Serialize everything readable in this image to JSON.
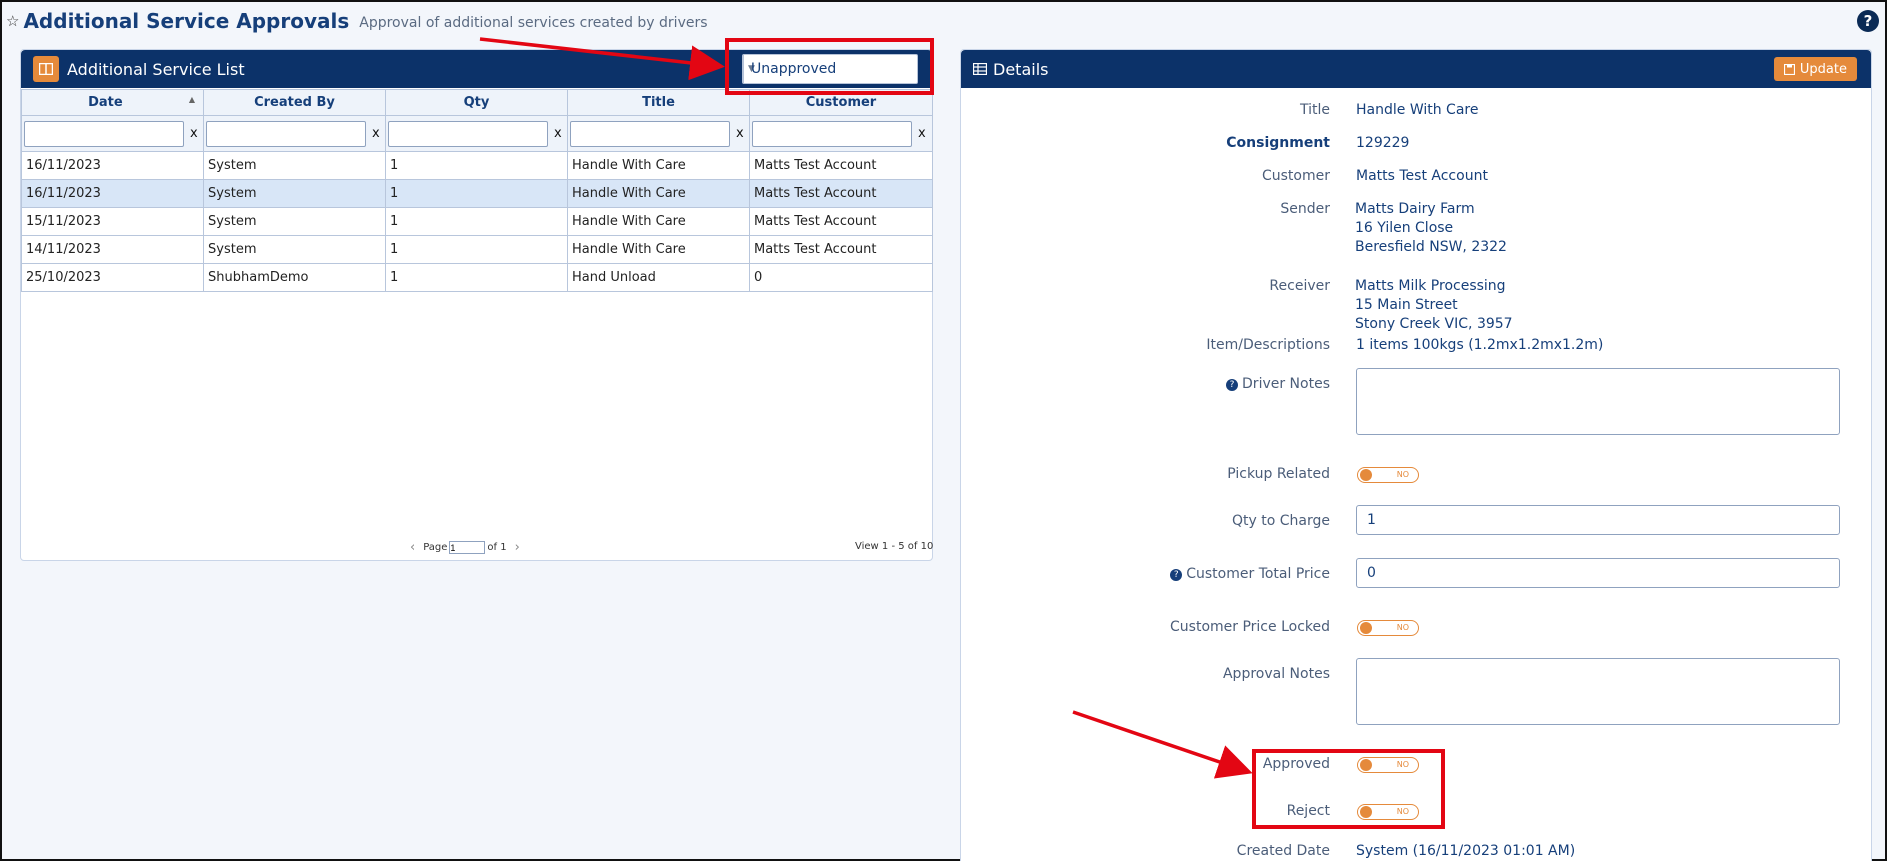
{
  "header": {
    "title": "Additional Service Approvals",
    "subtitle": "Approval of additional services created by drivers",
    "help": "?"
  },
  "list_panel": {
    "title": "Additional Service List",
    "status_filter": "Unapproved",
    "columns": [
      "Date",
      "Created By",
      "Qty",
      "Title",
      "Customer"
    ],
    "clear_label": "x",
    "rows": [
      {
        "date": "16/11/2023",
        "created_by": "System",
        "qty": "1",
        "title": "Handle With Care",
        "customer": "Matts Test Account"
      },
      {
        "date": "16/11/2023",
        "created_by": "System",
        "qty": "1",
        "title": "Handle With Care",
        "customer": "Matts Test Account"
      },
      {
        "date": "15/11/2023",
        "created_by": "System",
        "qty": "1",
        "title": "Handle With Care",
        "customer": "Matts Test Account"
      },
      {
        "date": "14/11/2023",
        "created_by": "System",
        "qty": "1",
        "title": "Handle With Care",
        "customer": "Matts Test Account"
      },
      {
        "date": "25/10/2023",
        "created_by": "ShubhamDemo",
        "qty": "1",
        "title": "Hand Unload",
        "customer": "0"
      }
    ],
    "pager": {
      "page_label": "Page",
      "page_value": "1",
      "of_label": "of 1"
    },
    "view_count": "View 1 - 5 of 10"
  },
  "details": {
    "title": "Details",
    "update_label": "Update",
    "labels": {
      "title": "Title",
      "consignment": "Consignment",
      "customer": "Customer",
      "sender": "Sender",
      "receiver": "Receiver",
      "items": "Item/Descriptions",
      "driver_notes": "Driver Notes",
      "pickup_related": "Pickup Related",
      "qty_to_charge": "Qty to Charge",
      "customer_total_price": "Customer Total Price",
      "customer_price_locked": "Customer Price Locked",
      "approval_notes": "Approval Notes",
      "approved": "Approved",
      "reject": "Reject",
      "created_date": "Created Date"
    },
    "values": {
      "title": "Handle With Care",
      "consignment": "129229",
      "customer": "Matts Test Account",
      "sender_line1": "Matts Dairy Farm",
      "sender_line2": "16 Yilen Close",
      "sender_line3": "Beresfield NSW, 2322",
      "receiver_line1": "Matts Milk Processing",
      "receiver_line2": "15 Main Street",
      "receiver_line3": "Stony Creek VIC, 3957",
      "items": "1 items 100kgs (1.2mx1.2mx1.2m)",
      "qty_to_charge": "1",
      "customer_total_price": "0",
      "created_date": "System (16/11/2023 01:01 AM)"
    },
    "toggle_off_label": "NO"
  },
  "colors": {
    "header_bar": "#0c3269",
    "accent": "#e58a3b",
    "annotation": "#e30613"
  }
}
